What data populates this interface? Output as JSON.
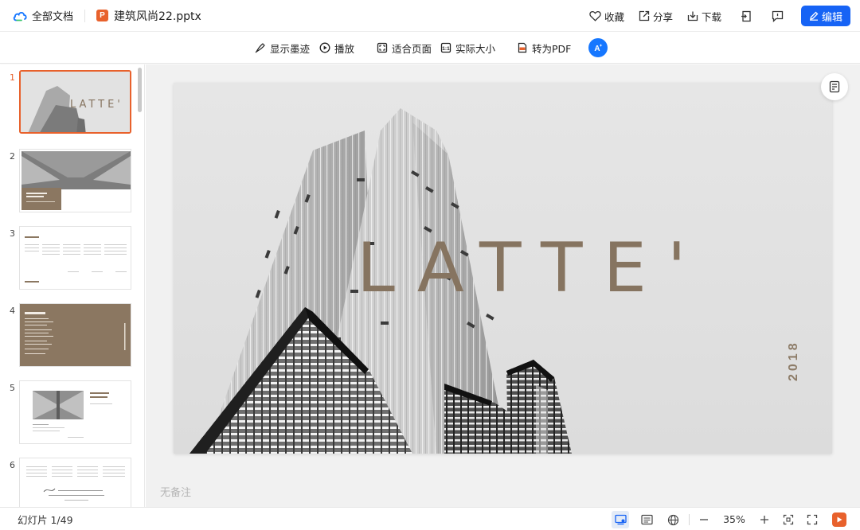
{
  "header": {
    "brand_label": "全部文档",
    "file_type_badge": "P",
    "file_name": "建筑风尚22.pptx",
    "actions": {
      "favorite": "收藏",
      "share": "分享",
      "download": "下载",
      "edit": "编辑"
    }
  },
  "toolbar": {
    "show_ink": "显示墨迹",
    "play": "播放",
    "fit_page": "适合页面",
    "actual_size": "实际大小",
    "to_pdf": "转为PDF"
  },
  "thumbnails": {
    "numbers": [
      "1",
      "2",
      "3",
      "4",
      "5",
      "6"
    ],
    "active_index": 0
  },
  "slide": {
    "title": "LATTE'",
    "year": "2018"
  },
  "notes": {
    "empty_label": "无备注"
  },
  "statusbar": {
    "slide_counter": "幻灯片 1/49",
    "zoom": "35%"
  },
  "colors": {
    "accent_blue": "#1663f5",
    "ppt_orange": "#e8612c",
    "latte_brown": "#867460"
  },
  "icons": {
    "cloud": "cloud-icon",
    "heart": "heart-icon",
    "share": "share-icon",
    "download": "download-icon",
    "exit": "exit-icon",
    "comment": "comment-icon",
    "ink": "ink-icon",
    "play": "play-icon",
    "fit": "fit-page-icon",
    "actual": "actual-size-icon",
    "pdf": "pdf-icon",
    "ai": "ai-icon"
  }
}
